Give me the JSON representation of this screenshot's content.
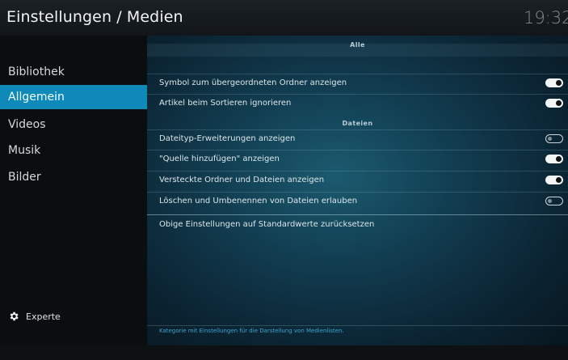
{
  "header": {
    "title": "Einstellungen / Medien",
    "clock": "19:32"
  },
  "sidebar": {
    "items": [
      {
        "label": "Bibliothek",
        "active": false
      },
      {
        "label": "Allgemein",
        "active": true
      },
      {
        "label": "Videos",
        "active": false
      },
      {
        "label": "Musik",
        "active": false
      },
      {
        "label": "Bilder",
        "active": false
      }
    ],
    "expert": {
      "label": "Experte",
      "icon": "gear-icon"
    }
  },
  "main": {
    "sections": [
      {
        "header": "Alle",
        "items": [
          {
            "label": "Symbol zum übergeordneten Ordner anzeigen",
            "enabled": true
          },
          {
            "label": "Artikel beim Sortieren ignorieren",
            "enabled": true
          }
        ]
      },
      {
        "header": "Dateien",
        "items": [
          {
            "label": "Dateityp-Erweiterungen anzeigen",
            "enabled": false
          },
          {
            "label": "\"Quelle hinzufügen\" anzeigen",
            "enabled": true
          },
          {
            "label": "Versteckte Ordner und Dateien anzeigen",
            "enabled": true
          },
          {
            "label": "Löschen und Umbenennen von Dateien erlauben",
            "enabled": false
          }
        ]
      }
    ],
    "reset_label": "Obige Einstellungen auf Standardwerte zurücksetzen",
    "hint": "Kategorie mit Einstellungen für die Darstellung von Medienlisten."
  },
  "colors": {
    "accent": "#0f89b9",
    "hint": "#3aa6d2"
  }
}
